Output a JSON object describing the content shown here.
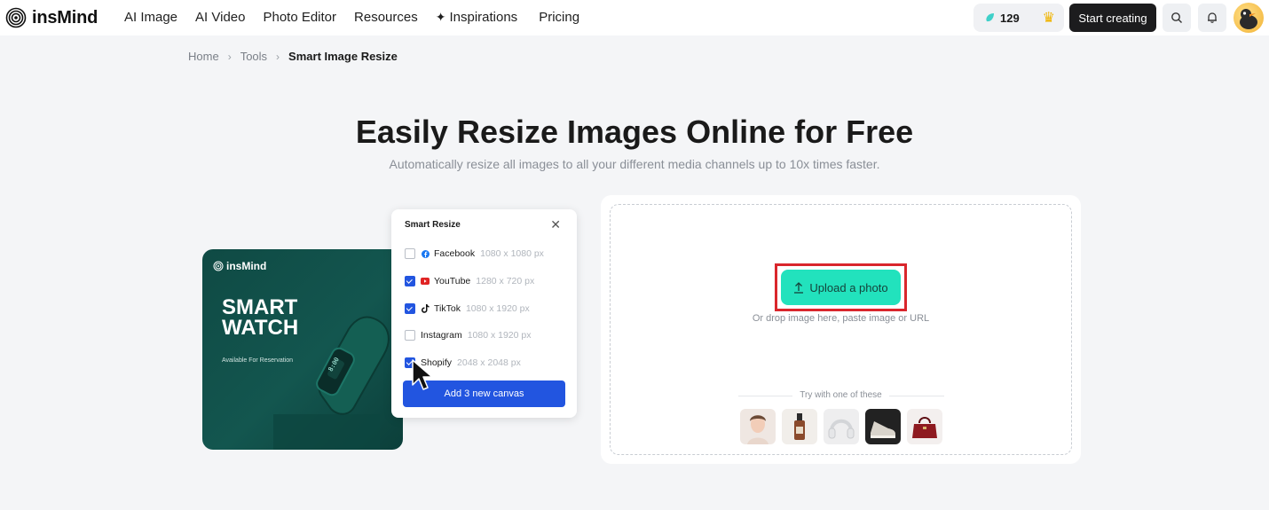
{
  "nav": {
    "brand": "insMind",
    "links": [
      "AI Image",
      "AI Video",
      "Photo Editor",
      "Resources",
      "Inspirations",
      "Pricing"
    ],
    "credits": "129",
    "start_label": "Start creating"
  },
  "breadcrumb": {
    "items": [
      "Home",
      "Tools",
      "Smart Image Resize"
    ]
  },
  "hero": {
    "title": "Easily Resize Images Online for Free",
    "subtitle": "Automatically resize all images to all your different media channels up to 10x times faster."
  },
  "promo": {
    "brand": "insMind",
    "title_line1": "SMART",
    "title_line2": "WATCH",
    "subtitle": "Available For Reservation"
  },
  "panel": {
    "title": "Smart Resize",
    "options": [
      {
        "label": "Facebook",
        "dims": "1080 x 1080 px",
        "checked": false,
        "icon": "facebook-icon",
        "color": "#1877f2"
      },
      {
        "label": "YouTube",
        "dims": "1280 x 720 px",
        "checked": true,
        "icon": "youtube-icon",
        "color": "#e02424"
      },
      {
        "label": "TikTok",
        "dims": "1080 x 1920 px",
        "checked": true,
        "icon": "tiktok-icon",
        "color": "#111111"
      },
      {
        "label": "Instagram",
        "dims": "1080 x 1920 px",
        "checked": false,
        "icon": "",
        "color": ""
      },
      {
        "label": "Shopify",
        "dims": "2048 x 2048 px",
        "checked": true,
        "icon": "",
        "color": ""
      }
    ],
    "add_label": "Add 3 new canvas"
  },
  "upload": {
    "button_label": "Upload a photo",
    "drop_text": "Or drop image here, paste image or URL",
    "try_text": "Try with one of these",
    "samples": [
      "woman-portrait",
      "serum-bottle",
      "headphones",
      "sneaker",
      "handbag"
    ]
  },
  "colors": {
    "accent_blue": "#2255e0",
    "upload_green": "#22e2bd",
    "highlight_red": "#d9262c",
    "promo_green": "#13564f"
  }
}
